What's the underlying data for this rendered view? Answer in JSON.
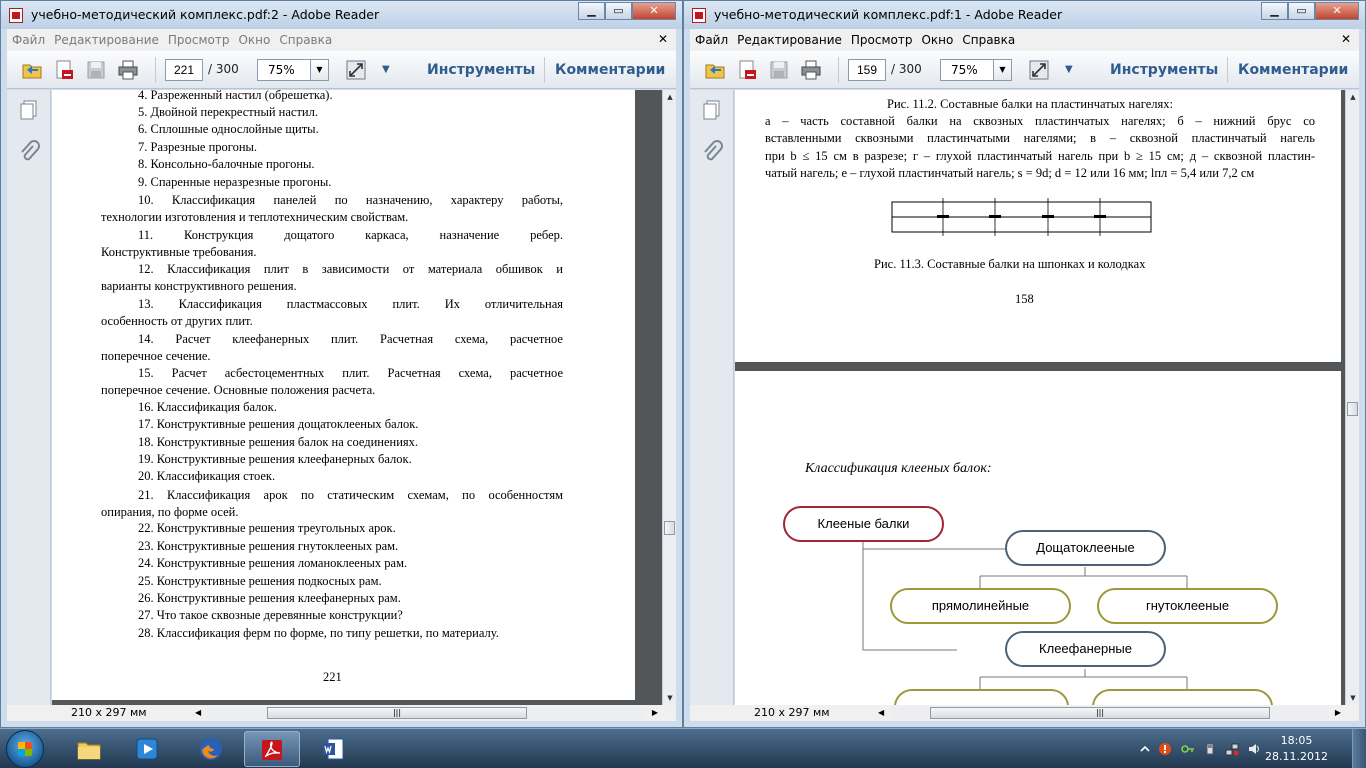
{
  "left_window": {
    "title": "учебно-методический комплекс.pdf:2 - Adobe Reader",
    "menu": [
      "Файл",
      "Редактирование",
      "Просмотр",
      "Окно",
      "Справка"
    ],
    "page_current": "221",
    "page_total": "/ 300",
    "zoom": "75%",
    "tools_label": "Инструменты",
    "comments_label": "Комментарии",
    "status_size": "210 x 297 мм",
    "page": {
      "questions": [
        "4.  Разреженный настил (обрешетка).",
        "5.  Двойной перекрестный настил.",
        "6.  Сплошные однослойные щиты.",
        "7.  Разрезные прогоны.",
        "8.  Консольно-балочные прогоны.",
        "9.  Спаренные неразрезные прогоны."
      ],
      "q10_a": "10. Классификация панелей по назначению, характеру работы,",
      "q10_b": "технологии изготовления и теплотехническим свойствам.",
      "q11_a": "11. Конструкция дощатого каркаса, назначение ребер.",
      "q11_b": "Конструктивные требования.",
      "q12_a": "12. Классификация плит в зависимости от материала обшивок и",
      "q12_b": "варианты конструктивного решения.",
      "q13_a": "13. Классификация пластмассовых плит. Их отличительная",
      "q13_b": "особенность от других плит.",
      "q14_a": "14. Расчет клеефанерных плит. Расчетная схема, расчетное",
      "q14_b": "поперечное сечение.",
      "q15_a": "15. Расчет асбестоцементных плит. Расчетная схема, расчетное",
      "q15_b": "поперечное сечение. Основные положения расчета.",
      "q16_20": [
        "16. Классификация балок.",
        "17. Конструктивные решения дощатоклееных балок.",
        "18. Конструктивные решения балок на соединениях.",
        "19. Конструктивные решения клеефанерных балок.",
        "20. Классификация стоек."
      ],
      "q21_a": "21. Классификация арок по статическим схемам, по особенностям",
      "q21_b": "опирания, по форме осей.",
      "q22_28": [
        "22. Конструктивные решения треугольных арок.",
        "23. Конструктивные решения гнутоклееных рам.",
        "24. Конструктивные решения ломаноклееных рам.",
        "25. Конструктивные решения подкосных рам.",
        "26. Конструктивные решения клеефанерных рам.",
        "27. Что такое сквозные деревянные конструкции?",
        "28. Классификация ферм по форме, по типу решетки, по материалу."
      ],
      "page_number": "221"
    }
  },
  "right_window": {
    "title": "учебно-методический комплекс.pdf:1 - Adobe Reader",
    "menu": [
      "Файл",
      "Редактирование",
      "Просмотр",
      "Окно",
      "Справка"
    ],
    "page_current": "159",
    "page_total": "/ 300",
    "zoom": "75%",
    "tools_label": "Инструменты",
    "comments_label": "Комментарии",
    "status_size": "210 x 297 мм",
    "page_top": {
      "fig_11_2_title": "Рис. 11.2. Составные балки на пластинчатых нагелях:",
      "fig_11_2_line1": "а – часть составной балки на сквозных пластинчатых нагелях; б – нижний брус со",
      "fig_11_2_line2": "вставленными сквозными пластинчатыми нагелями; в – сквозной пластинчатый нагель",
      "fig_11_2_line3": "при b ≤ 15 см в разрезе; г – глухой пластинчатый нагель при b ≥ 15 см; д – сквозной пластин-",
      "fig_11_2_line4": "чатый нагель; е – глухой пластинчатый нагель; s = 9d; d = 12 или 16 мм; lпл = 5,4 или 7,2 см",
      "fig_11_3_title": "Рис. 11.3. Составные балки на шпонках и колодках",
      "page_number": "158"
    },
    "page_bottom": {
      "classification_title": "Классификация клееных балок:",
      "node_root": "Клееные балки",
      "node_dosh": "Дощатоклееные",
      "node_straight": "прямолинейные",
      "node_bent": "гнутоклееные",
      "node_plywood": "Клеефанерные"
    }
  },
  "taskbar": {
    "time": "18:05",
    "date": "28.11.2012"
  },
  "colors": {
    "accent_link": "#2f5d8f",
    "node_red": "#a02535",
    "node_blue": "#4d6177",
    "node_olive": "#9a9a3b",
    "doc_background": "#525659"
  }
}
